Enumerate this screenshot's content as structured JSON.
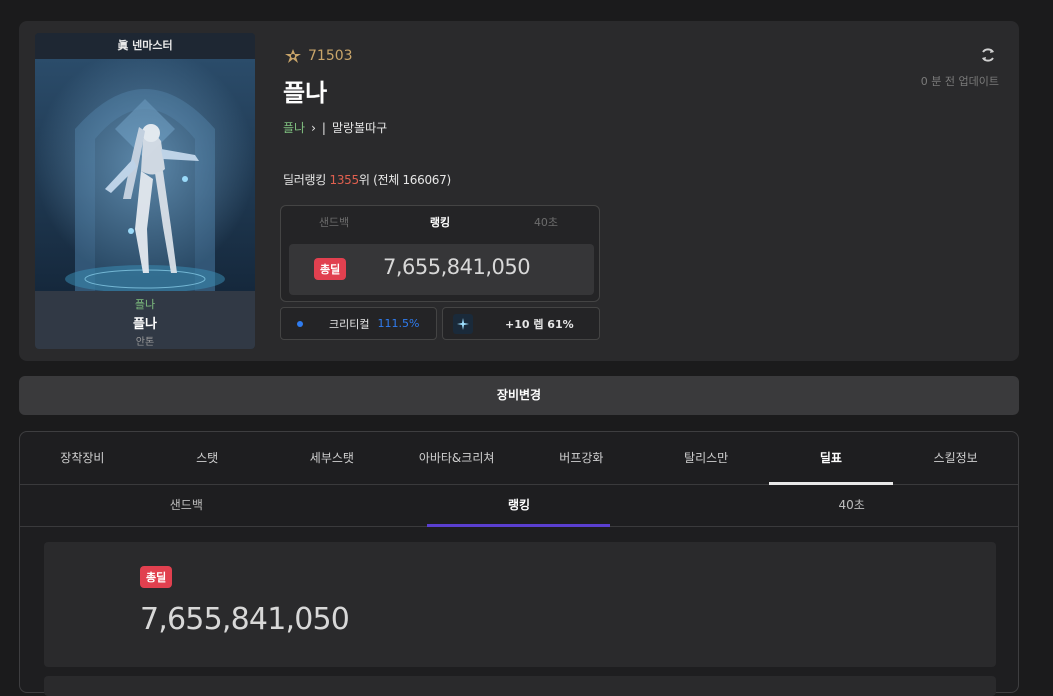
{
  "profile": {
    "class_name": "眞 넨마스터",
    "guild": "플나",
    "name": "플나",
    "server": "안톤",
    "fame": "71503",
    "advancement": "플나",
    "adventure": "말랑볼따구",
    "rank_prefix": "딜러랭킹 ",
    "rank_value": "1355",
    "rank_suffix": "위 (전체 166067)",
    "updated_num": "0",
    "updated_text": " 분 전 업데이트"
  },
  "damage_card": {
    "tabs": [
      "샌드백",
      "랭킹",
      "40초"
    ],
    "active_tab": "랭킹",
    "badge": "총딜",
    "value": "7,655,841,050"
  },
  "pills": {
    "crit_label": "크리티컬",
    "crit_value": "111.5%",
    "refine_label": "+10 렙 61%"
  },
  "equip_button": "장비변경",
  "main_tabs": [
    "장착장비",
    "스탯",
    "세부스탯",
    "아바타&크리쳐",
    "버프강화",
    "탈리스만",
    "딜표",
    "스킬정보"
  ],
  "active_main_tab": "딜표",
  "sub_tabs": [
    "샌드백",
    "랭킹",
    "40초"
  ],
  "active_sub_tab": "랭킹",
  "total": {
    "badge": "총딜",
    "value": "7,655,841,050"
  },
  "colors": {
    "accent_red": "#e1404f",
    "crit_blue": "#2f7cf0",
    "guild_green": "#7fbf7f",
    "tab_underline": "#5a3fd0"
  }
}
